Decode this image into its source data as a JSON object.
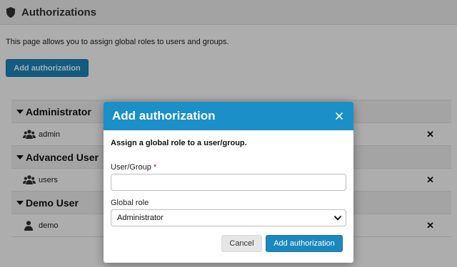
{
  "page": {
    "title": "Authorizations",
    "intro": "This page allows you to assign global roles to users and groups.",
    "add_button": "Add authorization",
    "remove_glyph": "✕"
  },
  "roles": [
    {
      "name": "Administrator",
      "member": {
        "name": "admin",
        "type": "group",
        "icon": "users-icon"
      }
    },
    {
      "name": "Advanced User",
      "member": {
        "name": "users",
        "type": "group",
        "icon": "users-icon"
      }
    },
    {
      "name": "Demo User",
      "member": {
        "name": "demo",
        "type": "user",
        "icon": "user-icon"
      }
    }
  ],
  "modal": {
    "title": "Add authorization",
    "description": "Assign a global role to a user/group.",
    "user_group_label": "User/Group",
    "required_mark": "*",
    "user_group_value": "",
    "global_role_label": "Global role",
    "global_role_value": "Administrator",
    "cancel_label": "Cancel",
    "submit_label": "Add authorization"
  },
  "colors": {
    "primary": "#1a88bd",
    "modal_header": "#1b8fc7",
    "required": "#d0021b"
  }
}
